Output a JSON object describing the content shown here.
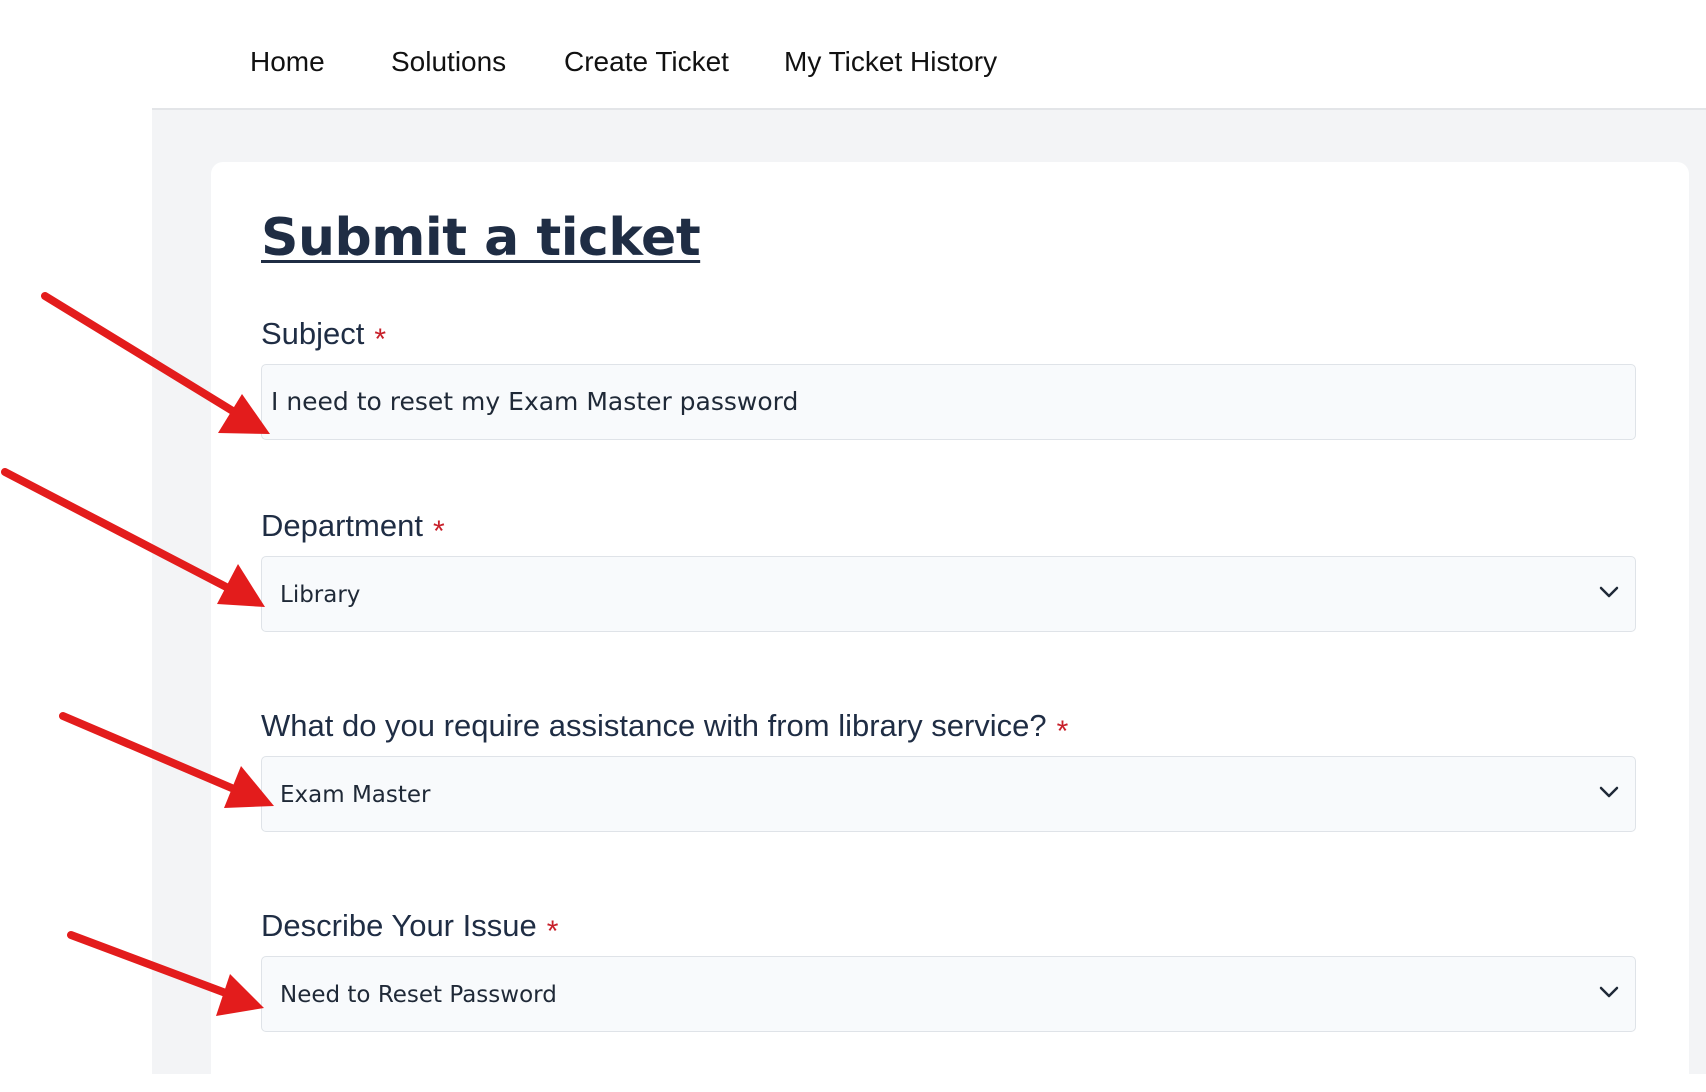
{
  "nav": {
    "items": [
      {
        "label": "Home"
      },
      {
        "label": "Solutions"
      },
      {
        "label": "Create Ticket"
      },
      {
        "label": "My Ticket History"
      }
    ]
  },
  "form": {
    "title": "Submit a ticket",
    "required_marker": "*",
    "subject": {
      "label": "Subject",
      "value": "I need to reset my Exam Master password"
    },
    "department": {
      "label": "Department",
      "value": "Library"
    },
    "assistance": {
      "label": "What do you require assistance with from library service?",
      "value": "Exam Master"
    },
    "issue": {
      "label": "Describe Your Issue",
      "value": "Need to Reset Password"
    }
  },
  "icons": {
    "dropdown": "chevron-down-icon",
    "annotation": "red-arrow-icon"
  },
  "colors": {
    "heading": "#1f2d44",
    "required": "#c8202a",
    "annotation_arrow": "#e31c1c",
    "page_background": "#f3f4f6",
    "field_background": "#f8fafc"
  }
}
